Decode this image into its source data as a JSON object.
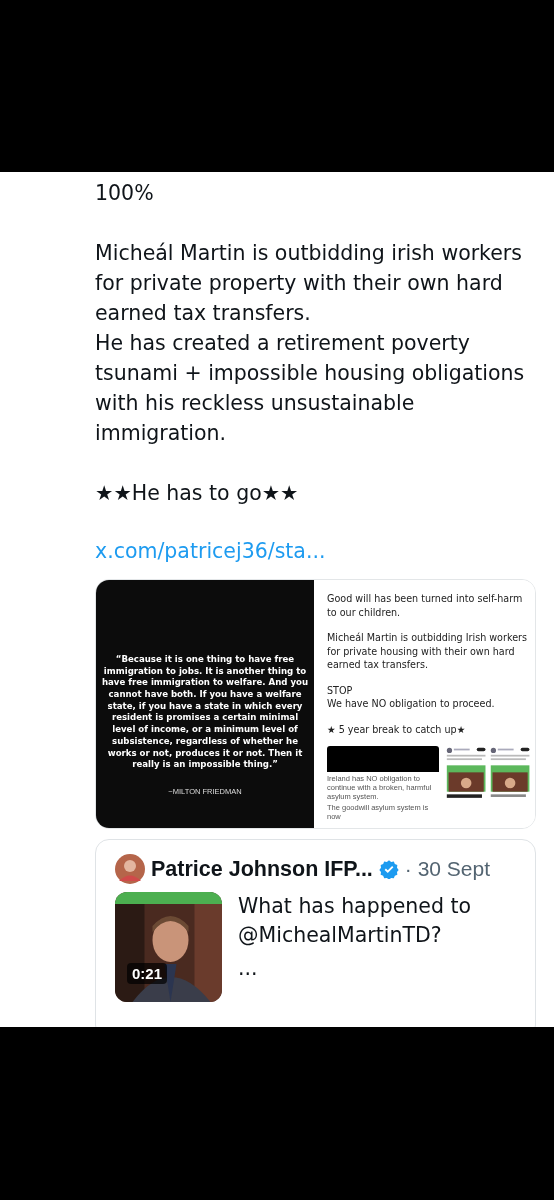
{
  "post": {
    "paragraphs": [
      [
        "100%"
      ],
      [
        "Micheál Martin is outbidding irish workers for private property with their own hard earned tax transfers.",
        "He has created a retirement poverty tsunami + impossible housing obligations with his reckless unsustainable immigration."
      ],
      [
        "★★He has to go★★"
      ]
    ],
    "link": "x.com/patricej36/sta..."
  },
  "media": [
    {
      "kind": "quote_card",
      "quote": "“Because it is one thing to have free immigration to jobs. It is another thing to have free immigration to welfare. And you cannot have both. If you have a welfare state, if you have a state in which every resident is promises a certain minimal level of income, or a minimum level of subsistence, regardless of whether he works or not, produces it or not. Then it really is an impossible thing.”",
      "attribution": "~MILTON FRIEDMAN"
    },
    {
      "kind": "screenshot",
      "paragraphs": [
        [
          "Good will has been turned into self-harm to our children."
        ],
        [
          "Micheál Martin is outbidding Irish workers for private housing with their own hard earned tax transfers."
        ],
        [
          "STOP",
          "We have NO obligation to proceed."
        ],
        [
          "★ 5 year break to catch up★"
        ]
      ],
      "captions": [
        "Ireland has NO obligation to continue with a broken, harmful asylum system.",
        "The goodwill asylum system is now"
      ]
    }
  ],
  "quoted_post": {
    "author": "Patrice Johnson IFP...",
    "verified": true,
    "date": "· 30 Sept",
    "video_duration": "0:21",
    "text": "What has happened to @MichealMartinTD?",
    "more": "..."
  }
}
